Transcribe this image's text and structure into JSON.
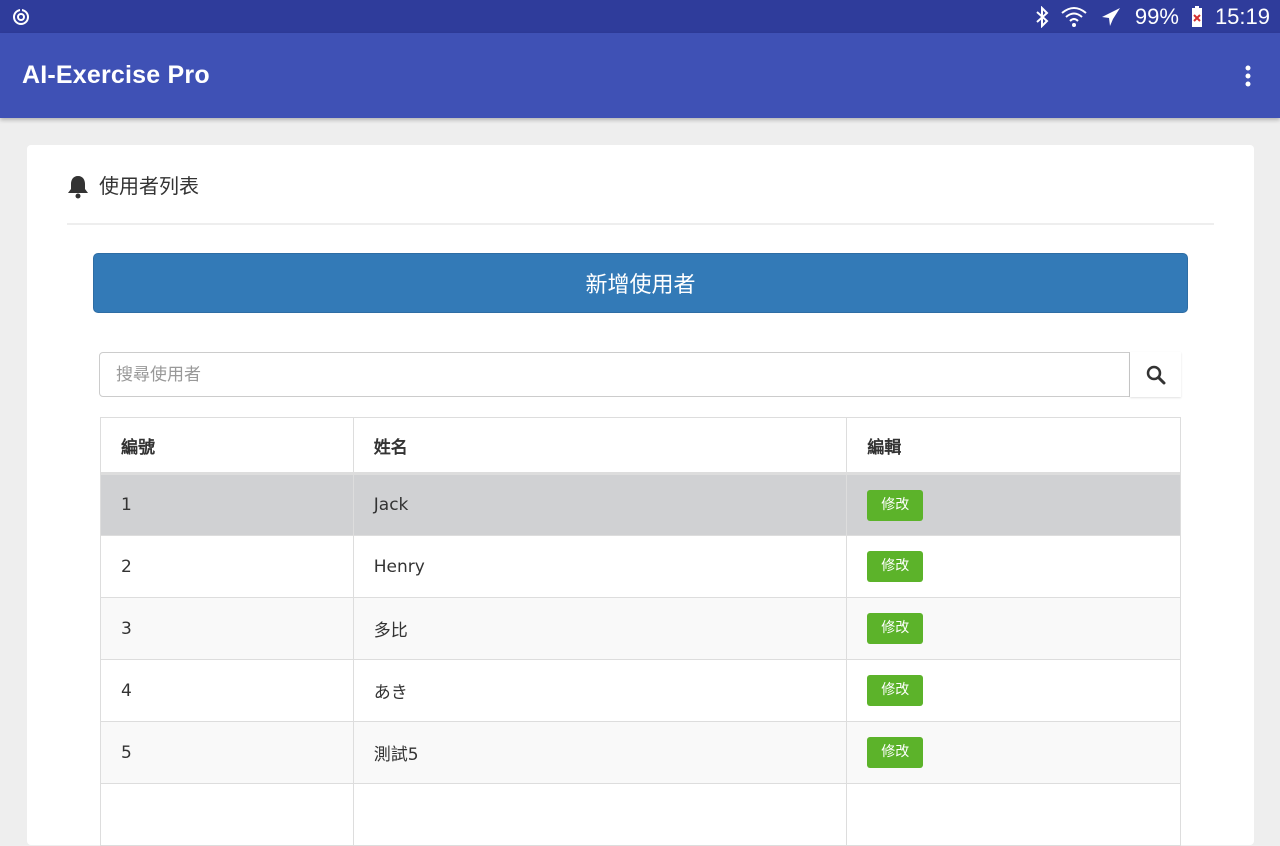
{
  "status_bar": {
    "battery": "99%",
    "time": "15:19",
    "icons": [
      "sync-icon",
      "bluetooth-icon",
      "wifi-icon",
      "airplane-mode-icon",
      "battery-icon"
    ]
  },
  "app_bar": {
    "title": "AI-Exercise Pro",
    "menu_icon": "more-vert-icon"
  },
  "card": {
    "title": "使用者列表",
    "title_icon": "bell-icon",
    "add_button_label": "新增使用者",
    "search": {
      "placeholder": "搜尋使用者",
      "value": "",
      "button_icon": "search-icon"
    },
    "table": {
      "headers": [
        "編號",
        "姓名",
        "編輯"
      ],
      "rows": [
        {
          "id": "1",
          "name": "Jack",
          "action": "修改"
        },
        {
          "id": "2",
          "name": "Henry",
          "action": "修改"
        },
        {
          "id": "3",
          "name": "多比",
          "action": "修改"
        },
        {
          "id": "4",
          "name": "あき",
          "action": "修改"
        },
        {
          "id": "5",
          "name": "測試5",
          "action": "修改"
        }
      ]
    }
  },
  "colors": {
    "status_bar": "#2f3c9b",
    "app_bar": "#3f51b5",
    "primary_button": "#337ab7",
    "edit_button": "#5cb32a",
    "selected_row": "#d0d1d3"
  }
}
